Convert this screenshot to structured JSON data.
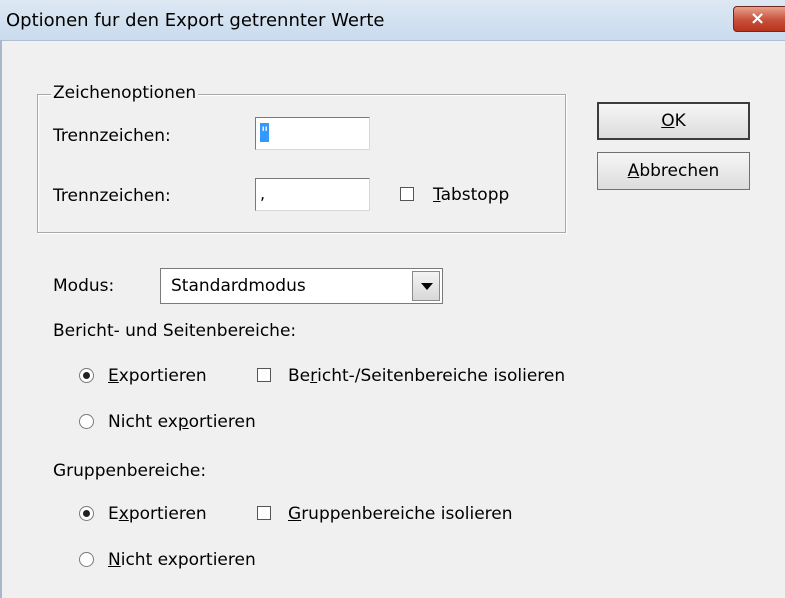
{
  "window": {
    "title": "Optionen fur den Export getrennter Werte",
    "close_icon": "×"
  },
  "zeichenoptionen": {
    "legend": "Zeichenoptionen",
    "row1": {
      "label": "Trennzeichen:",
      "value": "\""
    },
    "row2": {
      "label": "Trennzeichen:",
      "value": ",",
      "tab_pre": "",
      "tab_key": "T",
      "tab_post": "abstopp",
      "tab_checked": false
    }
  },
  "buttons": {
    "ok_pre": "",
    "ok_key": "O",
    "ok_post": "K",
    "cancel_pre": "",
    "cancel_key": "A",
    "cancel_post": "bbrechen"
  },
  "modus": {
    "label": "Modus:",
    "value": "Standardmodus"
  },
  "bericht": {
    "heading": "Bericht- und Seitenbereiche:",
    "export": {
      "pre": "",
      "key": "E",
      "post": "xportieren",
      "selected": true
    },
    "isolate": {
      "pre": "Be",
      "key": "r",
      "post": "icht-/Seitenbereiche isolieren",
      "checked": false
    },
    "noexport": {
      "pre": "Nicht ex",
      "key": "p",
      "post": "ortieren",
      "selected": false
    }
  },
  "gruppen": {
    "heading": "Gruppenbereiche:",
    "export": {
      "pre": "E",
      "key": "x",
      "post": "portieren",
      "selected": true
    },
    "isolate": {
      "pre": "",
      "key": "G",
      "post": "ruppenbereiche isolieren",
      "checked": false
    },
    "noexport": {
      "pre": "",
      "key": "N",
      "post": "icht exportieren",
      "selected": false
    }
  }
}
